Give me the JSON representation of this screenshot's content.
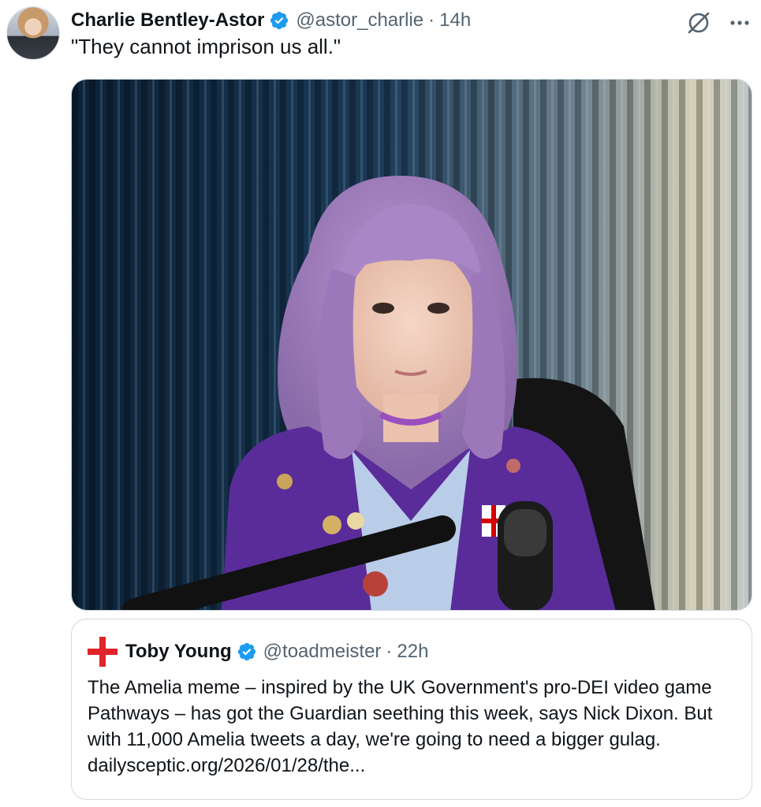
{
  "tweet": {
    "author_name": "Charlie Bentley-Astor",
    "handle": "@astor_charlie",
    "separator": "·",
    "time": "14h",
    "text": "\"They cannot imprison us all.\"",
    "verified": true,
    "icons": [
      "grok-icon",
      "more-icon"
    ]
  },
  "quoted_tweet": {
    "avatar_icon": "england-flag-icon",
    "author_name": "Toby Young",
    "handle": "@toadmeister",
    "separator": "·",
    "time": "22h",
    "verified": true,
    "text": "The Amelia meme – inspired by the UK Government's pro-DEI video game Pathways – has got the Guardian seething this week, says Nick Dixon. But with 11,000 Amelia tweets a day, we're going to need a bigger gulag. dailysceptic.org/2026/01/28/the..."
  },
  "colors": {
    "verified_blue": "#1d9bf0",
    "secondary_text": "#536471",
    "border": "#cfd9de"
  }
}
